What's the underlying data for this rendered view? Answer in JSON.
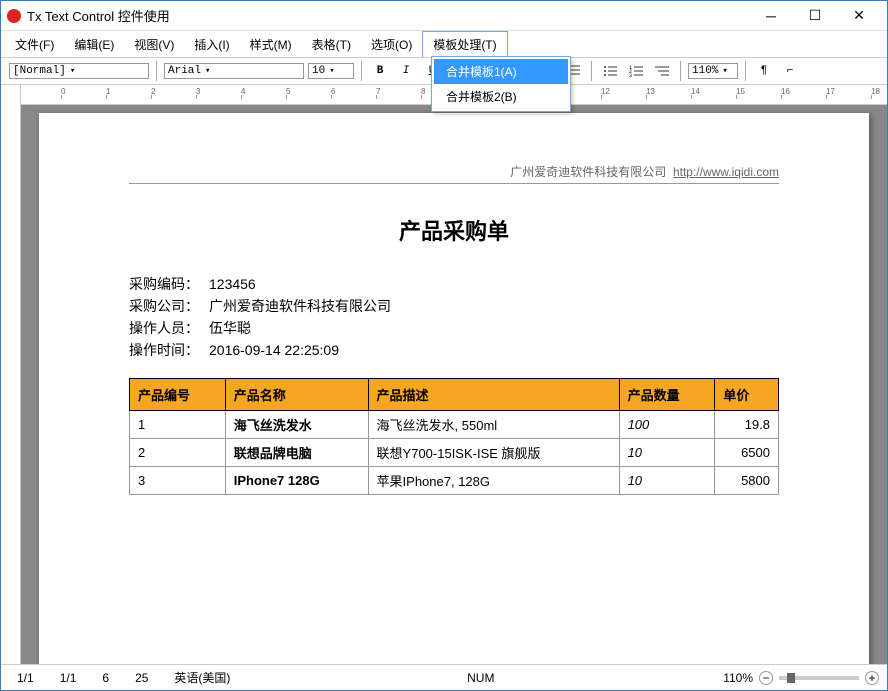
{
  "window": {
    "title": "Tx Text Control 控件使用"
  },
  "menus": [
    "文件(F)",
    "编辑(E)",
    "视图(V)",
    "插入(I)",
    "样式(M)",
    "表格(T)",
    "选项(O)",
    "模板处理(T)"
  ],
  "dropdown": {
    "items": [
      "合并模板1(A)",
      "合并模板2(B)"
    ],
    "highlight": 0
  },
  "toolbar": {
    "style": "[Normal]",
    "font": "Arial",
    "size": "10",
    "zoom": "110%"
  },
  "doc": {
    "company": "广州爱奇迪软件科技有限公司",
    "url": "http://www.iqidi.com",
    "title": "产品采购单",
    "info": [
      {
        "label": "采购编码：",
        "value": "123456"
      },
      {
        "label": "采购公司：",
        "value": "广州爱奇迪软件科技有限公司"
      },
      {
        "label": "操作人员：",
        "value": "伍华聪"
      },
      {
        "label": "操作时间：",
        "value": "2016-09-14 22:25:09"
      }
    ],
    "columns": [
      "产品编号",
      "产品名称",
      "产品描述",
      "产品数量",
      "单价"
    ],
    "rows": [
      {
        "id": "1",
        "name": "海飞丝洗发水",
        "desc": "海飞丝洗发水, 550ml",
        "qty": "100",
        "price": "19.8"
      },
      {
        "id": "2",
        "name": "联想品牌电脑",
        "desc": "联想Y700-15ISK-ISE 旗舰版",
        "qty": "10",
        "price": "6500"
      },
      {
        "id": "3",
        "name": "IPhone7 128G",
        "desc": "苹果IPhone7, 128G",
        "qty": "10",
        "price": "5800"
      }
    ]
  },
  "status": {
    "page": "1/1",
    "sec": "1/1",
    "line": "6",
    "col": "25",
    "lang": "英语(美国)",
    "mode": "NUM",
    "zoom": "110%"
  }
}
